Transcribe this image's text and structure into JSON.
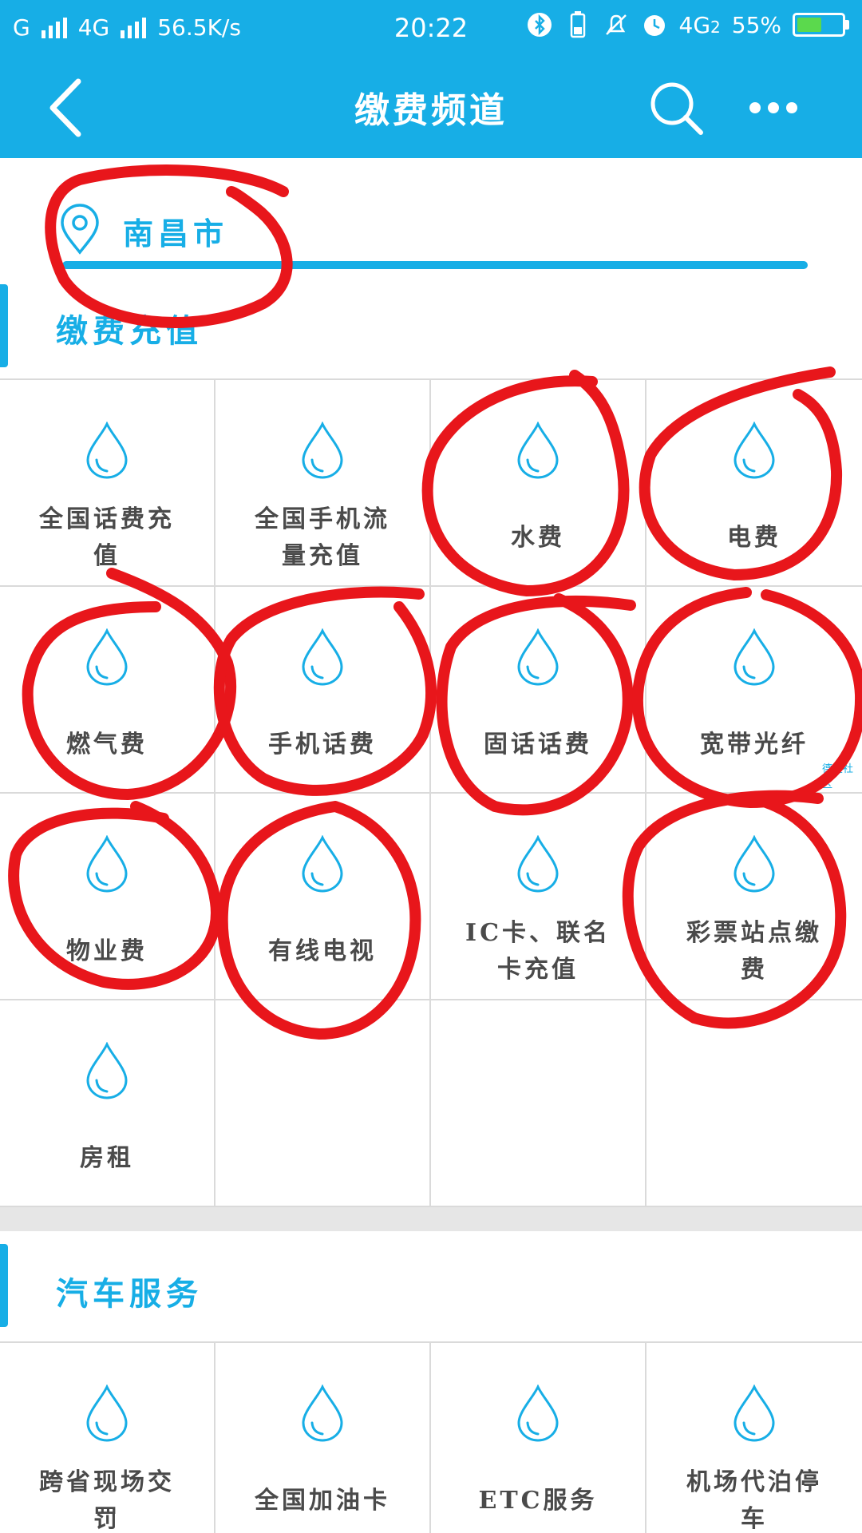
{
  "status_bar": {
    "carrier1": "G",
    "carrier2": "4G",
    "speed": "56.5K/s",
    "time": "20:22",
    "network": "4G",
    "sim": "2",
    "battery": "55%",
    "battery_level": 0.55,
    "icons": [
      "bluetooth-icon",
      "phone-battery-icon",
      "mute-bell-icon",
      "alarm-icon",
      "battery-icon"
    ]
  },
  "header": {
    "title": "缴费频道",
    "back_icon": "back-arrow-icon",
    "search_icon": "search-icon",
    "more_icon": "more-dots-icon",
    "color": "#17aee6"
  },
  "location": {
    "city": "南昌市",
    "icon": "location-pin-icon"
  },
  "section1": {
    "title": "缴费充值",
    "items": [
      {
        "label": "全国话费充值",
        "icon": "water-drop-icon"
      },
      {
        "label": "全国手机流量充值",
        "icon": "water-drop-icon"
      },
      {
        "label": "水费",
        "icon": "water-drop-icon"
      },
      {
        "label": "电费",
        "icon": "water-drop-icon"
      },
      {
        "label": "燃气费",
        "icon": "water-drop-icon"
      },
      {
        "label": "手机话费",
        "icon": "water-drop-icon"
      },
      {
        "label": "固话话费",
        "icon": "water-drop-icon"
      },
      {
        "label": "宽带光纤",
        "icon": "water-drop-icon"
      },
      {
        "label": "物业费",
        "icon": "water-drop-icon"
      },
      {
        "label": "有线电视",
        "icon": "water-drop-icon"
      },
      {
        "label": "IC卡、联名卡充值",
        "icon": "water-drop-icon"
      },
      {
        "label": "彩票站点缴费",
        "icon": "water-drop-icon"
      },
      {
        "label": "房租",
        "icon": "water-drop-icon"
      }
    ]
  },
  "section2": {
    "title": "汽车服务",
    "items": [
      {
        "label": "跨省现场交罚",
        "icon": "water-drop-icon"
      },
      {
        "label": "全国加油卡",
        "icon": "water-drop-icon"
      },
      {
        "label": "ETC服务",
        "icon": "water-drop-icon"
      },
      {
        "label": "机场代泊停车",
        "icon": "water-drop-icon"
      }
    ]
  },
  "ad_tag": "德星社区",
  "annotation_color": "#e8161b"
}
